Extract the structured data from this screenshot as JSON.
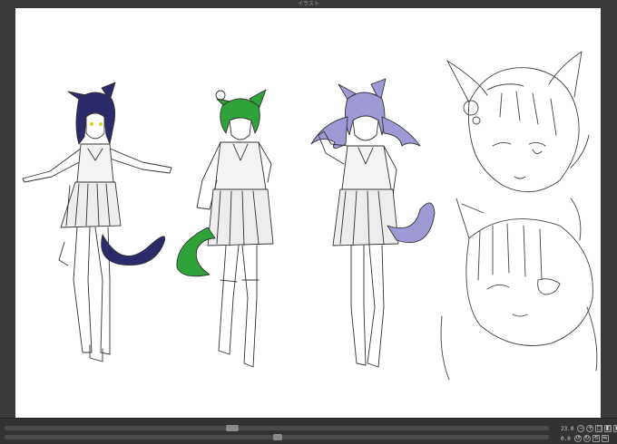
{
  "window": {
    "title": "イラスト"
  },
  "statusbar": {
    "zoom_value": "23.0",
    "angle_value": "0.0"
  },
  "colors": {
    "char1_hair": "#2b2a6a",
    "char2_hair": "#2fa33a",
    "char3_hair": "#9e9ad6",
    "canvas_bg": "#ffffff",
    "chrome_bg": "#3a3a3a"
  },
  "icons": {
    "zoom_out": "minus-icon",
    "zoom_in": "plus-icon",
    "fit": "fit-icon",
    "rotate_left": "rotate-left-icon",
    "rotate_right": "rotate-right-icon",
    "flip": "flip-icon",
    "reset": "reset-icon"
  }
}
